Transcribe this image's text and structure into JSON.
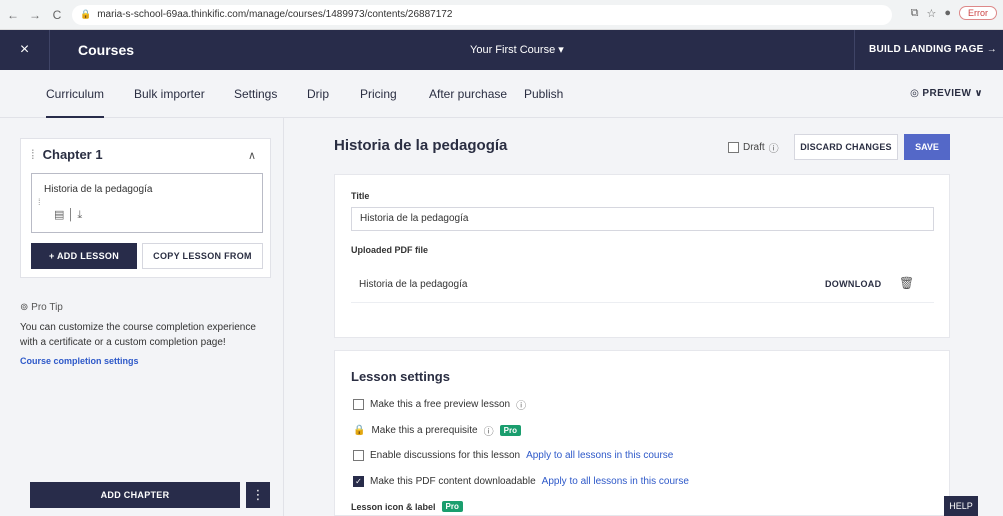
{
  "browser": {
    "back": "←",
    "forward": "→",
    "reload": "C",
    "url": "maria-s-school-69aa.thinkific.com/manage/courses/1489973/contents/26887172",
    "error_label": "Error"
  },
  "topbar": {
    "close": "×",
    "section": "Courses",
    "course_name": "Your First Course ▾",
    "build_landing": "BUILD LANDING PAGE →"
  },
  "tabs": [
    "Curriculum",
    "Bulk importer",
    "Settings",
    "Drip",
    "Pricing",
    "After purchase",
    "Publish"
  ],
  "preview_label": "PREVIEW ∨",
  "sidebar": {
    "chapter_title": "Chapter 1",
    "lesson_name": "Historia de la pedagogía",
    "add_lesson": "+ ADD LESSON",
    "copy_lesson": "COPY LESSON FROM",
    "protip_head": "Pro Tip",
    "protip_text": "You can customize the course completion experience with a certificate or a custom completion page!",
    "protip_link": "Course completion settings",
    "add_chapter": "ADD CHAPTER"
  },
  "lesson": {
    "title": "Historia de la pedagogía",
    "draft_label": "Draft",
    "discard": "DISCARD CHANGES",
    "save": "SAVE",
    "title_field_label": "Title",
    "title_value": "Historia de la pedagogía",
    "pdf_label": "Uploaded PDF file",
    "pdf_name": "Historia de la pedagogía",
    "download": "DOWNLOAD"
  },
  "settings": {
    "heading": "Lesson settings",
    "free_preview": "Make this a free preview lesson",
    "prerequisite": "Make this a prerequisite",
    "pro": "Pro",
    "discussions": "Enable discussions for this lesson",
    "apply_all": "Apply to all lessons in this course",
    "downloadable": "Make this PDF content downloadable",
    "icon_label": "Lesson icon & label"
  },
  "help": "HELP",
  "colors": {
    "navy": "#282c4a",
    "accent_blue": "#5468c8",
    "link": "#2e59c9",
    "pro_green": "#1a9e6e"
  }
}
